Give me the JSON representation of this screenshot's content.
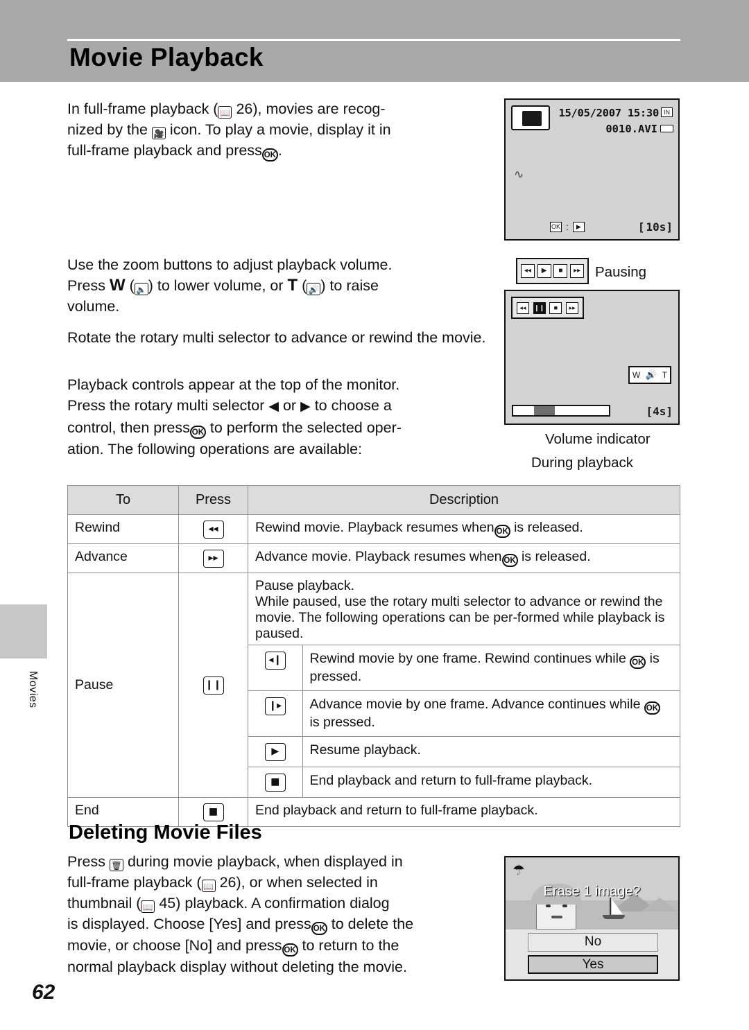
{
  "header": {
    "title": "Movie Playback"
  },
  "side_tab": {
    "label": "Movies"
  },
  "page_number": "62",
  "paragraphs": {
    "p1_a": "In  full-frame  playback  (",
    "p1_ref": "26), movies are recog-",
    "p1_b": "nized by the",
    "p1_c": "icon. To play a movie, display it in",
    "p1_d": "full-frame playback and press",
    "p1_e": ".",
    "p2_a": "Use the zoom buttons to adjust playback volume.",
    "p2_b": "Press",
    "p2_w": "W",
    "p2_c": ") to lower volume, or",
    "p2_t": "T",
    "p2_d": ") to raise",
    "p2_e": "volume.",
    "p3": "Rotate  the  rotary  multi  selector  to  advance  or rewind the movie.",
    "p4_a": "Playback controls appear at the top of the monitor.",
    "p4_b": "Press the rotary multi selector",
    "p4_c": "or",
    "p4_d": "to choose a",
    "p4_e": "control, then press",
    "p4_f": "to perform the selected oper-",
    "p4_g": "ation. The following operations are available:"
  },
  "monitor_top": {
    "date": "15/05/2007",
    "time": "15:30",
    "file": "0010.AVI",
    "duration": "10s",
    "movie_icon": "movie-camera-icon",
    "internal_memory_icon": "IN",
    "protect_icon": "battery-icon"
  },
  "monitor_mid": {
    "caption_pausing": "Pausing",
    "caption_volume": "Volume indicator",
    "caption_during": "During playback",
    "duration": "4s",
    "controls": [
      "rewind",
      "play",
      "stop",
      "end"
    ],
    "controls_paused": [
      "step-back",
      "pause",
      "stop",
      "step-fwd"
    ]
  },
  "table": {
    "headers": [
      "To",
      "Press",
      "Description"
    ],
    "rows": [
      {
        "to": "Rewind",
        "press_icon": "rewind-icon",
        "desc_a": "Rewind movie. Playback resumes when",
        "desc_b": "is released."
      },
      {
        "to": "Advance",
        "press_icon": "advance-icon",
        "desc_a": "Advance movie. Playback resumes when",
        "desc_b": "is released."
      },
      {
        "to": "Pause",
        "press_icon": "pause-icon",
        "desc_intro_1": "Pause playback.",
        "desc_intro_2": "While paused, use the rotary multi selector to advance or rewind the movie. The following operations can be per-formed while playback is paused.",
        "sub": [
          {
            "icon": "step-back-icon",
            "text_a": "Rewind movie by one frame. Rewind continues while",
            "text_b": "is pressed."
          },
          {
            "icon": "step-forward-icon",
            "text_a": "Advance movie by one frame. Advance continues while",
            "text_b": "is pressed."
          },
          {
            "icon": "play-icon",
            "text_a": "Resume playback.",
            "text_b": ""
          },
          {
            "icon": "stop-icon",
            "text_a": "End playback and return to full-frame playback.",
            "text_b": ""
          }
        ]
      },
      {
        "to": "End",
        "press_icon": "stop-icon",
        "desc_a": "End playback and return to full-frame playback.",
        "desc_b": ""
      }
    ]
  },
  "section2": {
    "heading": "Deleting Movie Files",
    "t_a": "Press",
    "t_b": "during  movie  playback,  when  displayed  in",
    "t_c": "full-frame   playback   (",
    "t_c2": "26),  or  when  selected  in",
    "t_d": "thumbnail (",
    "t_d2": "45) playback. A confirmation dialog",
    "t_e": "is displayed. Choose [Yes] and press",
    "t_e2": "to delete the",
    "t_f": "movie, or choose [No] and press",
    "t_f2": "to return to the",
    "t_g": "normal playback display without deleting the movie."
  },
  "erase_dialog": {
    "title": "Erase 1 image?",
    "no": "No",
    "yes": "Yes",
    "trash_icon": "trash-icon"
  },
  "colors": {
    "header_band": "#a8a8a8",
    "side_tab": "#c7c7c7",
    "monitor_bg": "#d3d3d3",
    "table_header": "#dcdcdc"
  }
}
